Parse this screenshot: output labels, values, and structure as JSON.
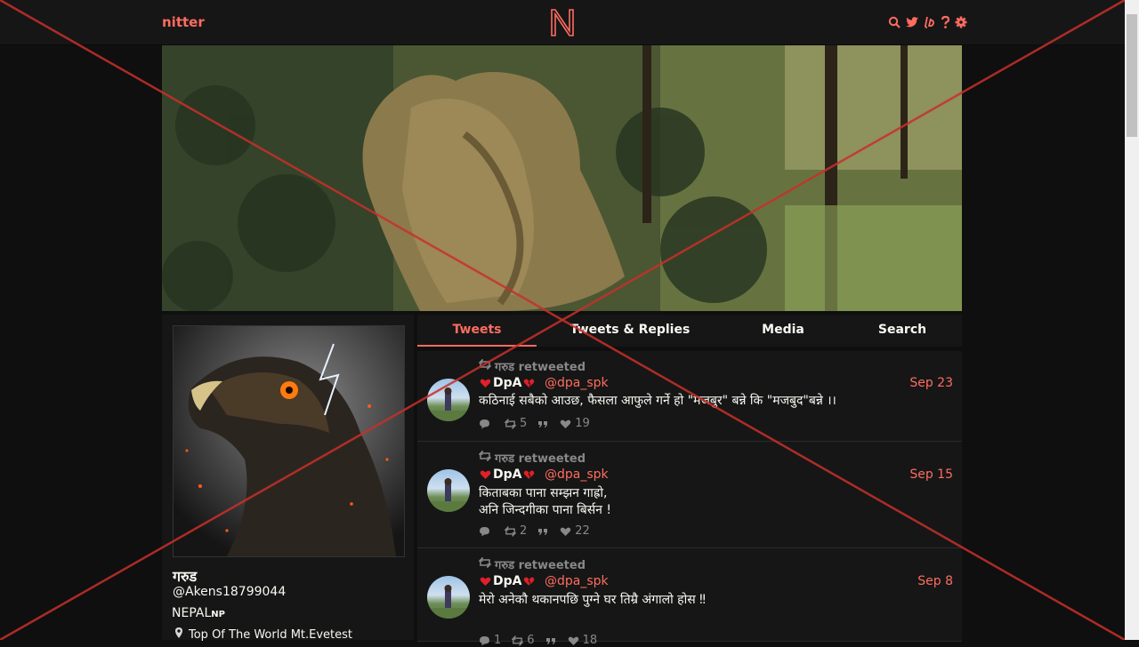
{
  "nav": {
    "brand": "nitter",
    "logo_letter": "N",
    "icons": [
      "search-icon",
      "twitter-icon",
      "liberapay-icon",
      "help-icon",
      "gear-icon"
    ]
  },
  "profile": {
    "fullname": "गरुड",
    "username": "@Akens18799044",
    "bio_main": "NEPAL",
    "bio_small": "NP",
    "location": "Top Of The World Mt.Evetest"
  },
  "tabs": [
    {
      "label": "Tweets",
      "active": true
    },
    {
      "label": "Tweets & Replies",
      "active": false
    },
    {
      "label": "Media",
      "active": false
    },
    {
      "label": "Search",
      "active": false
    }
  ],
  "tweets": [
    {
      "retweet_text": "गरुड retweeted",
      "fullname": "DpA",
      "handle": "@dpa_spk",
      "date": "Sep 23",
      "lines": [
        "कठिनाई सबैको आउछ, फैसला आफुले गर्ने हो \"मजबुर\" बन्ने कि \"मजबुद\"बन्ने ।।"
      ],
      "replies": "",
      "retweets": "5",
      "likes": "19"
    },
    {
      "retweet_text": "गरुड retweeted",
      "fullname": "DpA",
      "handle": "@dpa_spk",
      "date": "Sep 15",
      "lines": [
        "किताबका पाना सम्झन गाह्रो,",
        "अनि जिन्दगीका पाना बिर्सन !"
      ],
      "replies": "",
      "retweets": "2",
      "likes": "22"
    },
    {
      "retweet_text": "गरुड retweeted",
      "fullname": "DpA",
      "handle": "@dpa_spk",
      "date": "Sep 8",
      "lines": [
        "मेरो अनेकौ थकानपछि पुग्ने घर तिम्रै अंगालो होस ‼"
      ],
      "replies": "1",
      "retweets": "6",
      "likes": "18"
    }
  ],
  "colors": {
    "accent": "#ff6c60",
    "background": "#0f0f0f",
    "panel": "#161616",
    "muted": "#888889",
    "overlay_line": "#c8302a"
  }
}
